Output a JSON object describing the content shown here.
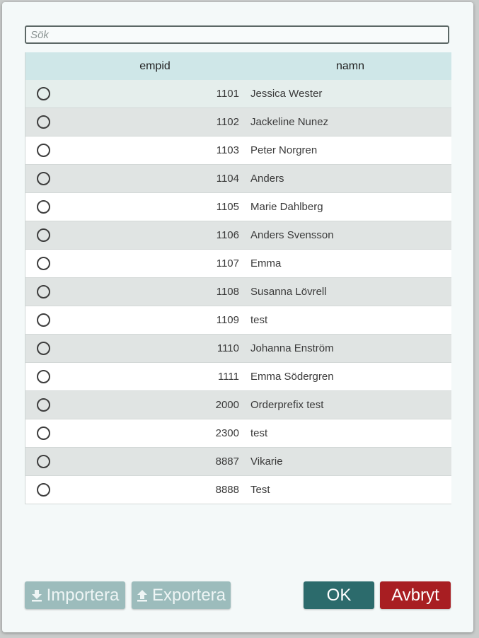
{
  "search": {
    "placeholder": "Sök"
  },
  "table": {
    "columns": {
      "empid": "empid",
      "namn": "namn"
    },
    "rows": [
      {
        "empid": "1101",
        "namn": "Jessica Wester"
      },
      {
        "empid": "1102",
        "namn": "Jackeline Nunez"
      },
      {
        "empid": "1103",
        "namn": "Peter Norgren"
      },
      {
        "empid": "1104",
        "namn": "Anders"
      },
      {
        "empid": "1105",
        "namn": "Marie Dahlberg"
      },
      {
        "empid": "1106",
        "namn": "Anders Svensson"
      },
      {
        "empid": "1107",
        "namn": "Emma"
      },
      {
        "empid": "1108",
        "namn": "Susanna Lövrell"
      },
      {
        "empid": "1109",
        "namn": "test"
      },
      {
        "empid": "1110",
        "namn": "Johanna Enström"
      },
      {
        "empid": "1111",
        "namn": "Emma Södergren"
      },
      {
        "empid": "2000",
        "namn": "Orderprefix test"
      },
      {
        "empid": "2300",
        "namn": "test"
      },
      {
        "empid": "8887",
        "namn": "Vikarie"
      },
      {
        "empid": "8888",
        "namn": "Test"
      }
    ]
  },
  "buttons": {
    "import_label": "Importera",
    "import_icon": "download-icon",
    "export_label": "Exportera",
    "export_icon": "upload-icon",
    "ok_label": "OK",
    "cancel_label": "Avbryt"
  },
  "colors": {
    "header_bg": "#cfe7e8",
    "ok_bg": "#2c6b6c",
    "cancel_bg": "#a81e22",
    "disabled_bg": "#9cbcbc"
  }
}
